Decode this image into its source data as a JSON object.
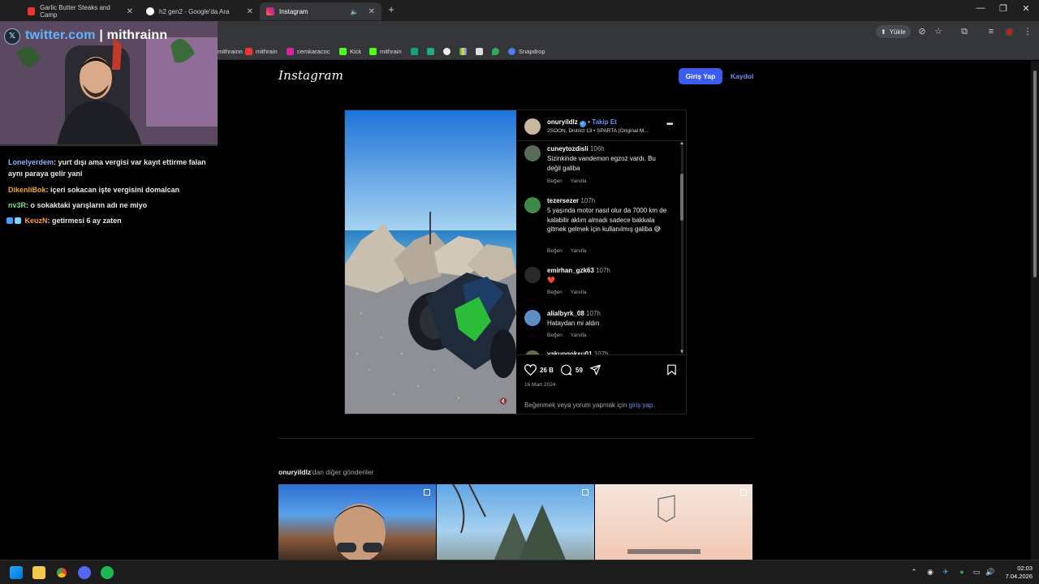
{
  "browser": {
    "tabs": [
      {
        "title": "Garlic Butter Steaks and Camp",
        "active": false
      },
      {
        "title": "h2 gen2 - Google'da Ara",
        "active": false
      },
      {
        "title": "Instagram",
        "active": true
      }
    ],
    "toolbar": {
      "upload_label": "Yükle"
    },
    "bookmarks": [
      "mithrainn",
      "mithrain",
      "cemkaracoc",
      "Kick",
      "mithrain",
      "Snapdrop"
    ]
  },
  "instagram": {
    "logo": "Instagram",
    "login_button": "Giriş Yap",
    "signup_link": "Kaydol",
    "post": {
      "username": "onuryildlz",
      "separator": "•",
      "follow": "Takip Et",
      "audio": "2SOON, District 13 • SPARTA (Original M...",
      "comments": [
        {
          "user": "cuneytozdisli",
          "time": "106h",
          "text": "Sizinkinde vandemon egzoz vardı. Bu değil galiba"
        },
        {
          "user": "tezersezer",
          "time": "107h",
          "text": "5 yaşında motor nasıl olur da 7000 km de kalabilir aklım almadı sadece bakkala gitmek gelmek için kullanılmış galiba 😅"
        },
        {
          "user": "emirhan_gzk63",
          "time": "107h",
          "text": "❤️"
        },
        {
          "user": "alialbyrk_08",
          "time": "107h",
          "text": "Hataydan mi aldın"
        },
        {
          "user": "yakupgoksu01",
          "time": "107h",
          "text": ""
        }
      ],
      "like_label": "Beğen",
      "reply_label": "Yanıtla",
      "likes": "26 B",
      "comment_count": "59",
      "date": "16 Mart 2024",
      "login_prompt_prefix": "Beğenmek veya yorum yapmak için ",
      "login_prompt_link": "giriş yap",
      "login_prompt_suffix": "."
    },
    "more_posts": {
      "username": "onuryildlz",
      "suffix": "'dan diğer gönderiler"
    }
  },
  "stream": {
    "twitter_handle": "twitter.com",
    "twitter_separator": "|",
    "twitter_user": "mithrainn",
    "chat": [
      {
        "user": "Lonelyerdem",
        "message": ": yurt dışı ama vergisi var kayıt ettirme falan aynı paraya gelir yani"
      },
      {
        "user": "DikenliBok",
        "message": ": içeri sokacan işte vergisini domalcan"
      },
      {
        "user": "nv3R",
        "message": ": o sokaktaki yarışların adı ne miyo"
      },
      {
        "user": "KeuzN",
        "message": ": getirmesi 6 ay zaten"
      }
    ]
  },
  "taskbar": {
    "time": "02:03",
    "date": "7.04.2026"
  },
  "colors": {
    "accent": "#3b5cf0",
    "link": "#6b8ff7",
    "background": "#000000"
  }
}
